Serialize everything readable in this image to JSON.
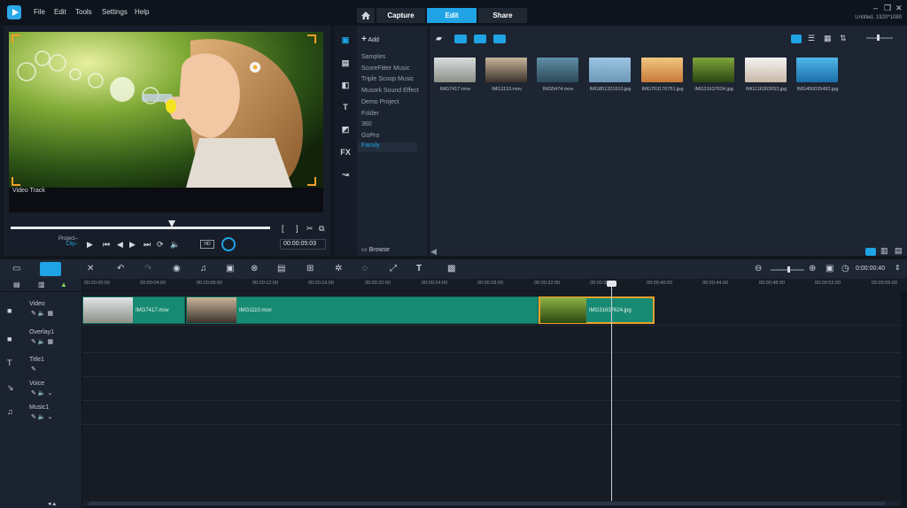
{
  "menu": {
    "file": "File",
    "edit": "Edit",
    "tools": "Tools",
    "settings": "Settings",
    "help": "Help"
  },
  "nav": {
    "capture": "Capture",
    "edit": "Edit",
    "share": "Share"
  },
  "window": {
    "project_info": "Untitled, 1920*1080"
  },
  "preview": {
    "track_label": "Video Track",
    "project_label": "Project–",
    "clip_label": "Clip–",
    "timecode": "00:00:05:03",
    "quality": "HD"
  },
  "library": {
    "add_label": "Add",
    "browse_label": "Browse",
    "folders": [
      "Samples",
      "ScoreFitter Music",
      "Triple Scoop Music",
      "Musork Sound Effect",
      "Demo Project",
      "Folder",
      "360",
      "GoPro",
      "Family"
    ],
    "selected_folder": "Family",
    "media": [
      {
        "name": "IMG7417.mov",
        "checked": true
      },
      {
        "name": "IMG1110.mov",
        "checked": true
      },
      {
        "name": "IMG5474.mov",
        "checked": false
      },
      {
        "name": "IMG851321610.jpg",
        "checked": false
      },
      {
        "name": "IMG703176751.jpg",
        "checked": false
      },
      {
        "name": "IMG31637624.jpg",
        "checked": true
      },
      {
        "name": "IMG116303053.jpg",
        "checked": false
      },
      {
        "name": "IMG456035492.jpg",
        "checked": false
      }
    ]
  },
  "timeline": {
    "timecode": "0:00:00:40",
    "ruler": [
      "00:00:00:00",
      "00:00:04:00",
      "00:00:08:00",
      "00:00:12:00",
      "00:00:16:00",
      "00:00:20:00",
      "00:00:24:00",
      "00:00:28:00",
      "00:00:32:00",
      "00:00:36:00",
      "00:00:40:00",
      "00:00:44:00",
      "00:00:48:00",
      "00:00:52:00",
      "00:00:56:00"
    ],
    "tracks": [
      "Video",
      "Overlay1",
      "Title1",
      "Voice",
      "Music1"
    ],
    "clips": [
      {
        "name": "IMG7417.mov"
      },
      {
        "name": "IMG1110.mov"
      },
      {
        "name": "IMG31637624.jpg"
      }
    ]
  },
  "colors": {
    "accent": "#1fa3e5",
    "clip": "#178a73",
    "selection": "#f0a02a"
  }
}
